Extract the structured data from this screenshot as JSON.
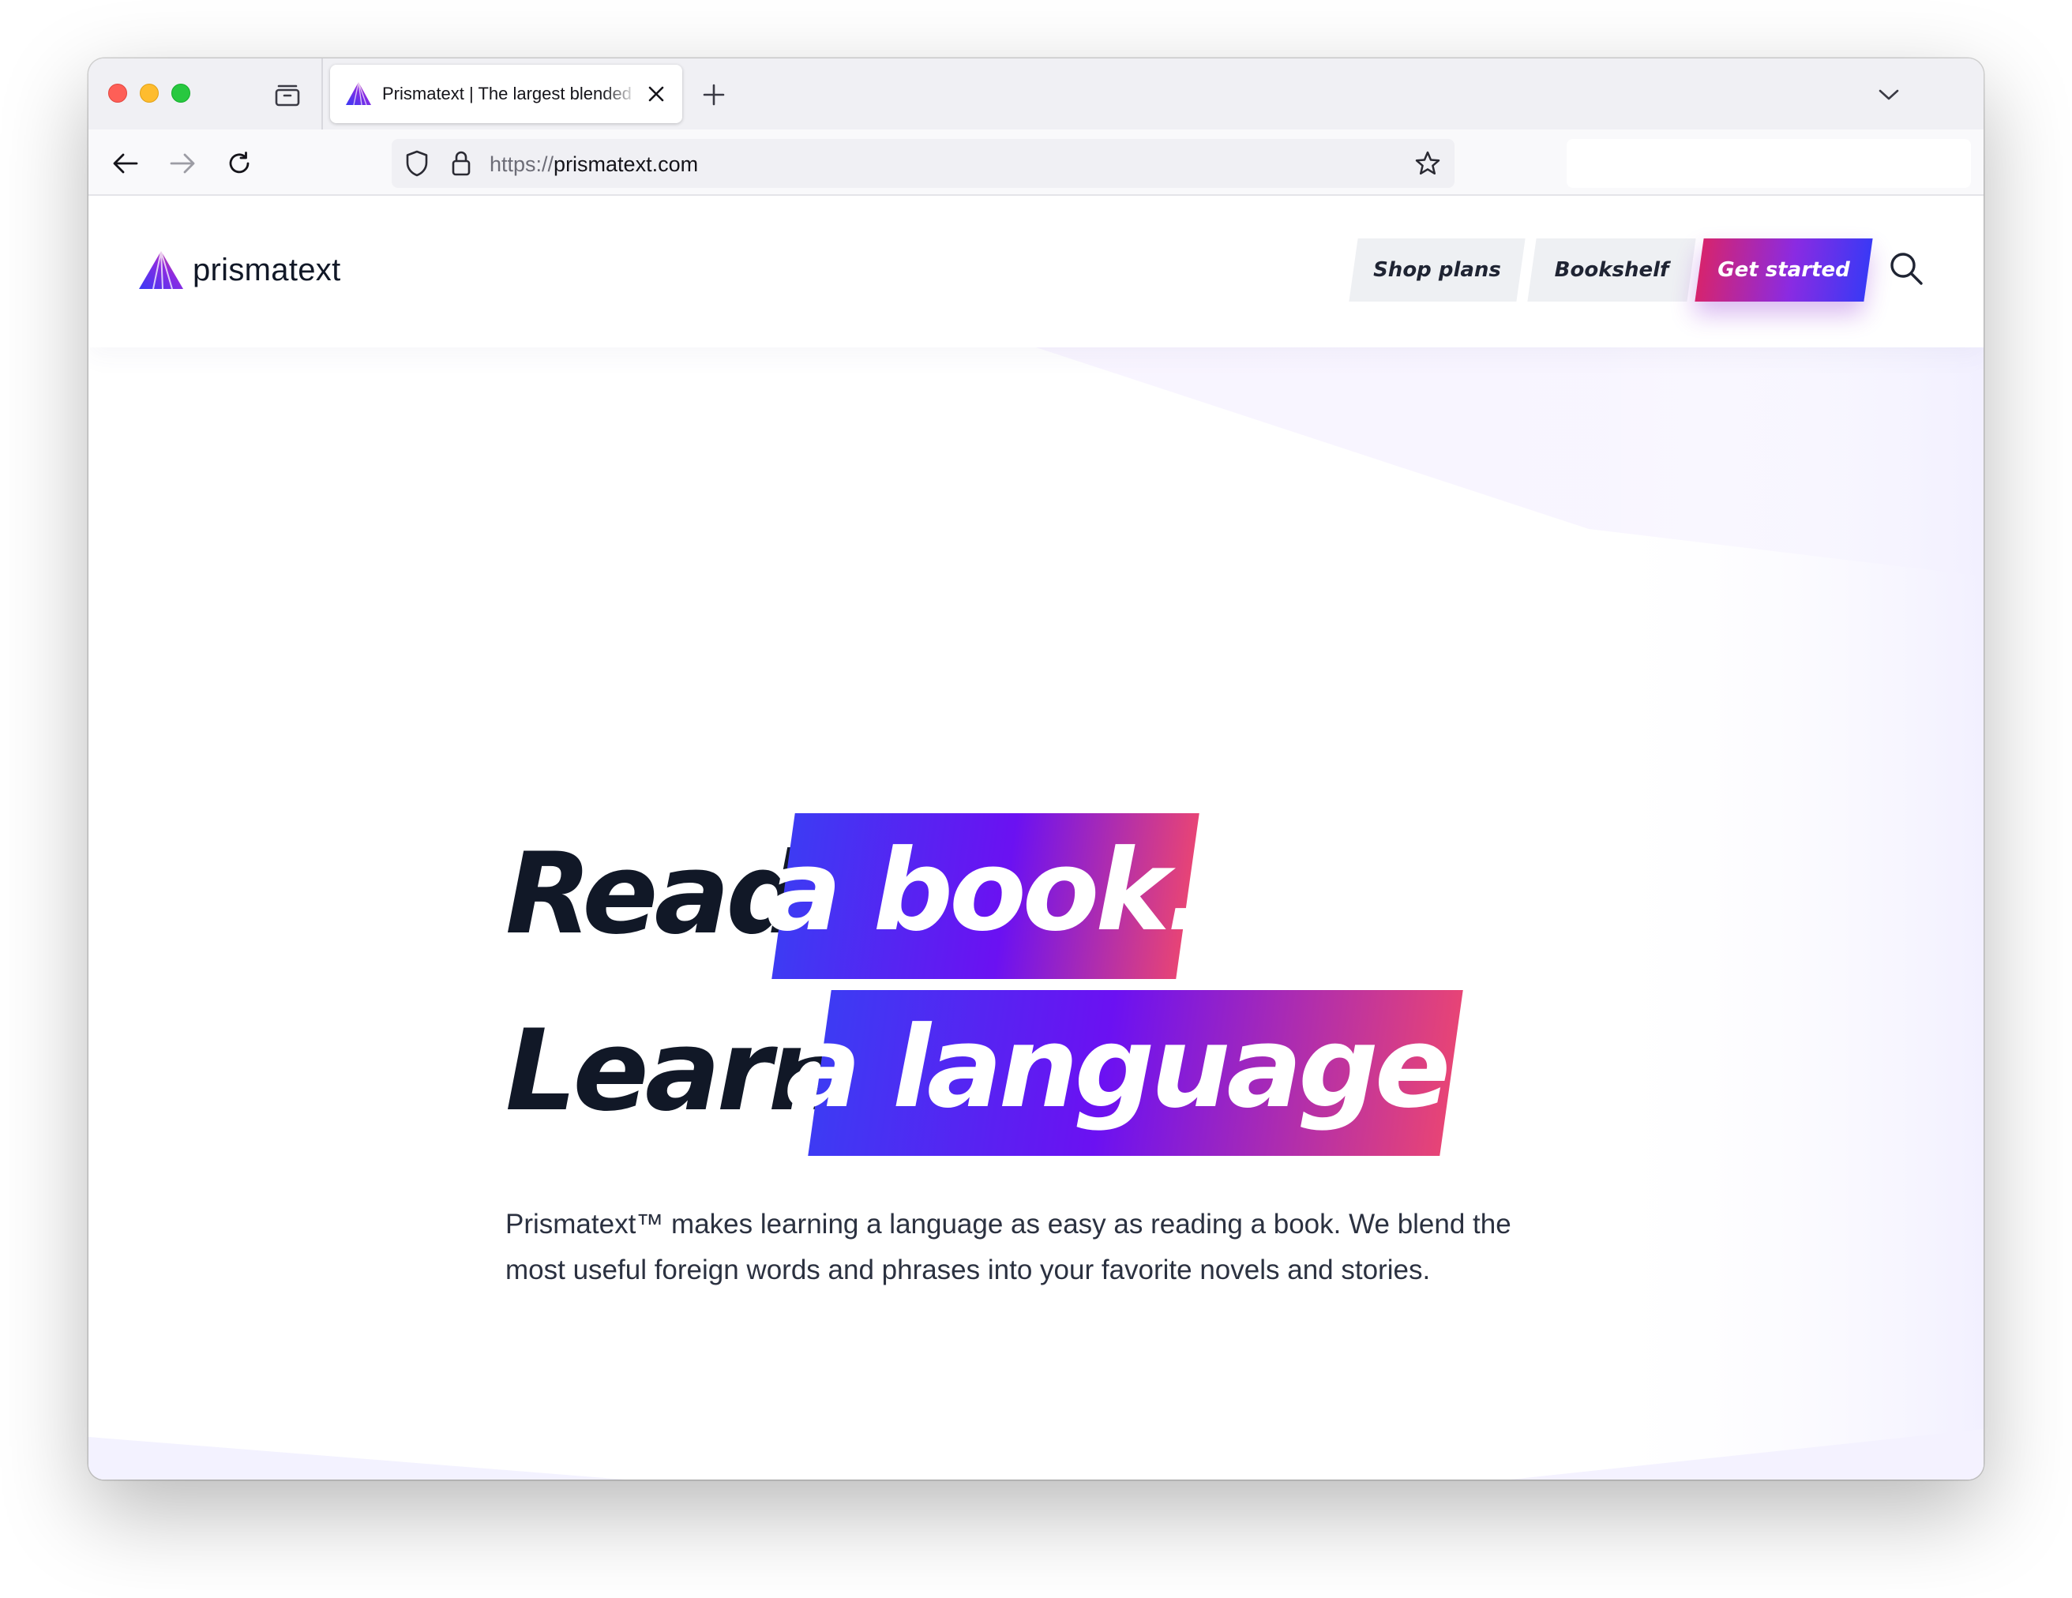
{
  "browser": {
    "tab": {
      "title": "Prismatext | The largest blended"
    },
    "url": {
      "scheme": "https://",
      "host": "prismatext.com"
    }
  },
  "site": {
    "brand": "prismatext",
    "nav": {
      "shop_plans": "Shop plans",
      "bookshelf": "Bookshelf",
      "get_started": "Get started"
    },
    "hero": {
      "line1_plain": "Read",
      "line1_highlight": "a book.",
      "line2_plain": "Learn",
      "line2_highlight": "a language.",
      "subtitle": "Prismatext™ makes learning a language as easy as reading a book. We blend the most useful foreign words and phrases into your favorite novels and stories."
    }
  },
  "colors": {
    "heading": "#111827",
    "highlight_gradient": [
      "#3d3bf3",
      "#6b11f2",
      "#e74476"
    ],
    "cta_gradient": [
      "#d6246e",
      "#8a2be2",
      "#3a39f5"
    ],
    "background_tint": "#f3f2ff"
  },
  "icons": [
    "tab-overview-icon",
    "close-icon",
    "plus-icon",
    "chevron-down-icon",
    "back-arrow-icon",
    "forward-arrow-icon",
    "reload-icon",
    "shield-icon",
    "lock-icon",
    "star-icon",
    "search-icon",
    "logo-icon"
  ]
}
